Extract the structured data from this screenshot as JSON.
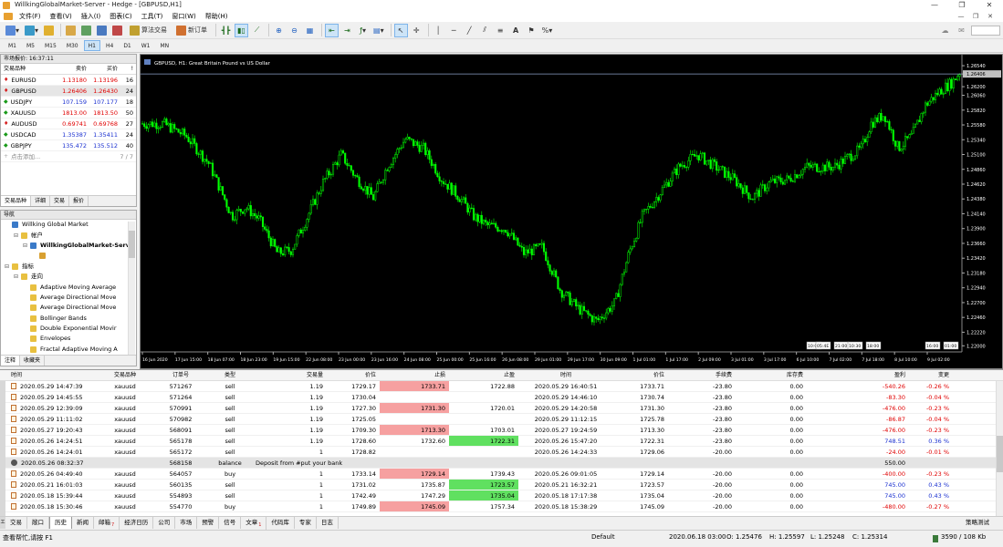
{
  "window": {
    "title": "WillkingGlobalMarket-Server - Hedge - [GBPUSD,H1]",
    "minimize": "—",
    "restore": "❐",
    "close": "✕"
  },
  "menu": [
    "文件(F)",
    "查看(V)",
    "插入(I)",
    "图表(C)",
    "工具(T)",
    "窗口(W)",
    "帮助(H)"
  ],
  "toolbar": {
    "algo_label": "算法交易",
    "neworder_label": "新订单"
  },
  "timeframes": [
    "M1",
    "M5",
    "M15",
    "M30",
    "H1",
    "H4",
    "D1",
    "W1",
    "MN"
  ],
  "active_timeframe": "H1",
  "market_watch": {
    "title": "市场报价: 16:37:11",
    "columns": [
      "交易品种",
      "卖价",
      "买价",
      "!"
    ],
    "rows": [
      {
        "symbol": "EURUSD",
        "bid": "1.13180",
        "ask": "1.13196",
        "spread": "16",
        "dir": "down",
        "color": "red"
      },
      {
        "symbol": "GBPUSD",
        "bid": "1.26406",
        "ask": "1.26430",
        "spread": "24",
        "dir": "down",
        "color": "red"
      },
      {
        "symbol": "USDJPY",
        "bid": "107.159",
        "ask": "107.177",
        "spread": "18",
        "dir": "up",
        "color": "blue"
      },
      {
        "symbol": "XAUUSD",
        "bid": "1813.00",
        "ask": "1813.50",
        "spread": "50",
        "dir": "up",
        "color": "red"
      },
      {
        "symbol": "AUDUSD",
        "bid": "0.69741",
        "ask": "0.69768",
        "spread": "27",
        "dir": "down",
        "color": "red"
      },
      {
        "symbol": "USDCAD",
        "bid": "1.35387",
        "ask": "1.35411",
        "spread": "24",
        "dir": "up",
        "color": "blue"
      },
      {
        "symbol": "GBPJPY",
        "bid": "135.472",
        "ask": "135.512",
        "spread": "40",
        "dir": "up",
        "color": "blue"
      }
    ],
    "add_label": "点击添加...",
    "count": "7 / 7",
    "tabs": [
      "交易品种",
      "详细",
      "交易",
      "报价"
    ]
  },
  "navigator": {
    "title": "导航",
    "items": [
      {
        "label": "Willking Global Market",
        "indent": 0,
        "icon": "server",
        "toggle": ""
      },
      {
        "label": "帐户",
        "indent": 1,
        "icon": "folder",
        "toggle": "⊟"
      },
      {
        "label": "WillkingGlobalMarket-Serve",
        "indent": 2,
        "icon": "server",
        "toggle": "⊟"
      },
      {
        "label": "",
        "indent": 3,
        "icon": "account",
        "toggle": ""
      },
      {
        "label": "指标",
        "indent": 0,
        "icon": "folder",
        "toggle": "⊟"
      },
      {
        "label": "走向",
        "indent": 1,
        "icon": "folder",
        "toggle": "⊟"
      },
      {
        "label": "Adaptive Moving Average",
        "indent": 2,
        "icon": "indicator",
        "toggle": ""
      },
      {
        "label": "Average Directional Move",
        "indent": 2,
        "icon": "indicator",
        "toggle": ""
      },
      {
        "label": "Average Directional Move",
        "indent": 2,
        "icon": "indicator",
        "toggle": ""
      },
      {
        "label": "Bollinger Bands",
        "indent": 2,
        "icon": "indicator",
        "toggle": ""
      },
      {
        "label": "Double Exponential Movir",
        "indent": 2,
        "icon": "indicator",
        "toggle": ""
      },
      {
        "label": "Envelopes",
        "indent": 2,
        "icon": "indicator",
        "toggle": ""
      },
      {
        "label": "Fractal Adaptive Moving A",
        "indent": 2,
        "icon": "indicator",
        "toggle": ""
      }
    ],
    "tabs": [
      "注释",
      "收藏夹"
    ]
  },
  "chart": {
    "label": "GBPUSD, H1:  Great Britain Pound vs US Dollar",
    "price_labels": [
      "1.26540",
      "1.26406",
      "1.26200",
      "1.26060",
      "1.25820",
      "1.25580",
      "1.25340",
      "1.25100",
      "1.24860",
      "1.24620",
      "1.24380",
      "1.24140",
      "1.23900",
      "1.23660",
      "1.23420",
      "1.23180",
      "1.22940",
      "1.22700",
      "1.22460",
      "1.22220",
      "1.22000"
    ],
    "current_price": "1.26406",
    "time_labels": [
      "16 Jun 2020",
      "17 Jun 15:00",
      "18 Jun 07:00",
      "18 Jun 23:00",
      "19 Jun 15:00",
      "22 Jun 08:00",
      "23 Jun 00:00",
      "23 Jun 16:00",
      "24 Jun 08:00",
      "25 Jun 00:00",
      "25 Jun 16:00",
      "26 Jun 08:00",
      "29 Jun 01:00",
      "29 Jun 17:00",
      "30 Jun 09:00",
      "1 Jul 01:00",
      "1 Jul 17:00",
      "2 Jul 09:00",
      "3 Jul 01:00",
      "3 Jul 17:00",
      "6 Jul 10:00",
      "7 Jul 02:00",
      "7 Jul 18:00",
      "8 Jul 10:00",
      "9 Jul 02:00"
    ],
    "markers": [
      "10:00",
      "05:4E",
      "21:00",
      "10:30",
      "18:00",
      "16:00",
      "01:00"
    ],
    "colors": {
      "bg": "#000000",
      "candle": "#00ff00",
      "grid": "#444444",
      "text": "#ffffff",
      "bidline": "#8ca0c8"
    }
  },
  "terminal": {
    "columns": [
      "时间",
      "交易品种",
      "订单号",
      "类型",
      "交易量",
      "价位",
      "止损",
      "止盈",
      "时间",
      "价位",
      "手续费",
      "库存费",
      "盈利",
      "变更"
    ],
    "rows": [
      {
        "kind": "trade",
        "time": "2020.05.29 14:47:39",
        "symbol": "xauusd",
        "order": "571267",
        "type": "sell",
        "volume": "1.19",
        "price": "1729.17",
        "sl": "1733.71",
        "sl_hl": "red",
        "tp": "1722.88",
        "tp_hl": "",
        "ctime": "2020.05.29 16:40:51",
        "cprice": "1733.71",
        "comm": "-23.80",
        "swap": "0.00",
        "profit": "-540.26",
        "pclass": "red",
        "change": "-0.26 %",
        "cclass": "red"
      },
      {
        "kind": "trade",
        "time": "2020.05.29 14:45:55",
        "symbol": "xauusd",
        "order": "571264",
        "type": "sell",
        "volume": "1.19",
        "price": "1730.04",
        "sl": "",
        "sl_hl": "",
        "tp": "",
        "tp_hl": "",
        "ctime": "2020.05.29 14:46:10",
        "cprice": "1730.74",
        "comm": "-23.80",
        "swap": "0.00",
        "profit": "-83.30",
        "pclass": "red",
        "change": "-0.04 %",
        "cclass": "red"
      },
      {
        "kind": "trade",
        "time": "2020.05.29 12:39:09",
        "symbol": "xauusd",
        "order": "570991",
        "type": "sell",
        "volume": "1.19",
        "price": "1727.30",
        "sl": "1731.30",
        "sl_hl": "red",
        "tp": "1720.01",
        "tp_hl": "",
        "ctime": "2020.05.29 14:20:58",
        "cprice": "1731.30",
        "comm": "-23.80",
        "swap": "0.00",
        "profit": "-476.00",
        "pclass": "red",
        "change": "-0.23 %",
        "cclass": "red"
      },
      {
        "kind": "trade",
        "time": "2020.05.29 11:11:02",
        "symbol": "xauusd",
        "order": "570982",
        "type": "sell",
        "volume": "1.19",
        "price": "1725.05",
        "sl": "",
        "sl_hl": "",
        "tp": "",
        "tp_hl": "",
        "ctime": "2020.05.29 11:12:15",
        "cprice": "1725.78",
        "comm": "-23.80",
        "swap": "0.00",
        "profit": "-86.87",
        "pclass": "red",
        "change": "-0.04 %",
        "cclass": "red"
      },
      {
        "kind": "trade",
        "time": "2020.05.27 19:20:43",
        "symbol": "xauusd",
        "order": "568091",
        "type": "sell",
        "volume": "1.19",
        "price": "1709.30",
        "sl": "1713.30",
        "sl_hl": "red",
        "tp": "1703.01",
        "tp_hl": "",
        "ctime": "2020.05.27 19:24:59",
        "cprice": "1713.30",
        "comm": "-23.80",
        "swap": "0.00",
        "profit": "-476.00",
        "pclass": "red",
        "change": "-0.23 %",
        "cclass": "red"
      },
      {
        "kind": "trade",
        "time": "2020.05.26 14:24:51",
        "symbol": "xauusd",
        "order": "565178",
        "type": "sell",
        "volume": "1.19",
        "price": "1728.60",
        "sl": "1732.60",
        "sl_hl": "",
        "tp": "1722.31",
        "tp_hl": "green",
        "ctime": "2020.05.26 15:47:20",
        "cprice": "1722.31",
        "comm": "-23.80",
        "swap": "0.00",
        "profit": "748.51",
        "pclass": "blue",
        "change": "0.36 %",
        "cclass": "blue"
      },
      {
        "kind": "trade",
        "time": "2020.05.26 14:24:01",
        "symbol": "xauusd",
        "order": "565172",
        "type": "sell",
        "volume": "1",
        "price": "1728.82",
        "sl": "",
        "sl_hl": "",
        "tp": "",
        "tp_hl": "",
        "ctime": "2020.05.26 14:24:33",
        "cprice": "1729.06",
        "comm": "-20.00",
        "swap": "0.00",
        "profit": "-24.00",
        "pclass": "red",
        "change": "-0.01 %",
        "cclass": "red"
      },
      {
        "kind": "balance",
        "time": "2020.05.26 08:32:37",
        "symbol": "",
        "order": "568158",
        "type": "balance",
        "volume": "Deposit from #put your bank",
        "price": "",
        "sl": "",
        "sl_hl": "",
        "tp": "",
        "tp_hl": "",
        "ctime": "",
        "cprice": "",
        "comm": "",
        "swap": "",
        "profit": "550.00",
        "pclass": "",
        "change": "",
        "cclass": ""
      },
      {
        "kind": "trade",
        "time": "2020.05.26 04:49:40",
        "symbol": "xauusd",
        "order": "564057",
        "type": "buy",
        "volume": "1",
        "price": "1733.14",
        "sl": "1729.14",
        "sl_hl": "red",
        "tp": "1739.43",
        "tp_hl": "",
        "ctime": "2020.05.26 09:01:05",
        "cprice": "1729.14",
        "comm": "-20.00",
        "swap": "0.00",
        "profit": "-400.00",
        "pclass": "red",
        "change": "-0.23 %",
        "cclass": "red"
      },
      {
        "kind": "trade",
        "time": "2020.05.21 16:01:03",
        "symbol": "xauusd",
        "order": "560135",
        "type": "sell",
        "volume": "1",
        "price": "1731.02",
        "sl": "1735.87",
        "sl_hl": "",
        "tp": "1723.57",
        "tp_hl": "green",
        "ctime": "2020.05.21 16:32:21",
        "cprice": "1723.57",
        "comm": "-20.00",
        "swap": "0.00",
        "profit": "745.00",
        "pclass": "blue",
        "change": "0.43 %",
        "cclass": "blue"
      },
      {
        "kind": "trade",
        "time": "2020.05.18 15:39:44",
        "symbol": "xauusd",
        "order": "554893",
        "type": "sell",
        "volume": "1",
        "price": "1742.49",
        "sl": "1747.29",
        "sl_hl": "",
        "tp": "1735.04",
        "tp_hl": "green",
        "ctime": "2020.05.18 17:17:38",
        "cprice": "1735.04",
        "comm": "-20.00",
        "swap": "0.00",
        "profit": "745.00",
        "pclass": "blue",
        "change": "0.43 %",
        "cclass": "blue"
      },
      {
        "kind": "trade",
        "time": "2020.05.18 15:30:46",
        "symbol": "xauusd",
        "order": "554770",
        "type": "buy",
        "volume": "1",
        "price": "1749.89",
        "sl": "1745.09",
        "sl_hl": "red",
        "tp": "1757.34",
        "tp_hl": "",
        "ctime": "2020.05.18 15:38:29",
        "cprice": "1745.09",
        "comm": "-20.00",
        "swap": "0.00",
        "profit": "-480.00",
        "pclass": "red",
        "change": "-0.27 %",
        "cclass": "red"
      }
    ],
    "tabs": [
      {
        "label": "交易",
        "badge": ""
      },
      {
        "label": "敞口",
        "badge": ""
      },
      {
        "label": "历史",
        "badge": ""
      },
      {
        "label": "新闻",
        "badge": ""
      },
      {
        "label": "邮箱",
        "badge": "7"
      },
      {
        "label": "经济日历",
        "badge": ""
      },
      {
        "label": "公司",
        "badge": ""
      },
      {
        "label": "市场",
        "badge": ""
      },
      {
        "label": "预警",
        "badge": ""
      },
      {
        "label": "信号",
        "badge": ""
      },
      {
        "label": "文章",
        "badge": "1"
      },
      {
        "label": "代码库",
        "badge": ""
      },
      {
        "label": "专家",
        "badge": ""
      },
      {
        "label": "日志",
        "badge": ""
      }
    ],
    "active_tab": "历史",
    "side_label": "工具箱",
    "tester_label": "策略测试"
  },
  "status": {
    "help": "查看帮忙,请按 F1",
    "profile": "Default",
    "datetime": "2020.06.18 03:00",
    "open": "O: 1.25476",
    "high": "H: 1.25597",
    "low": "L: 1.25248",
    "close": "C: 1.25314",
    "traffic": "3590 / 108 Kb"
  }
}
